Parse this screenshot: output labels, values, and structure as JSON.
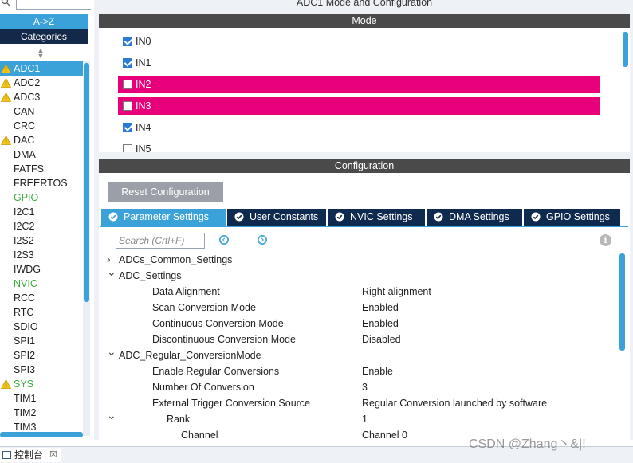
{
  "sidebar": {
    "az_label": "A->Z",
    "categories_label": "Categories",
    "items": [
      {
        "label": "ADC1",
        "warn": true,
        "selected": true,
        "green": false
      },
      {
        "label": "ADC2",
        "warn": true,
        "selected": false,
        "green": false
      },
      {
        "label": "ADC3",
        "warn": true,
        "selected": false,
        "green": false
      },
      {
        "label": "CAN",
        "warn": false,
        "selected": false,
        "green": false
      },
      {
        "label": "CRC",
        "warn": false,
        "selected": false,
        "green": false
      },
      {
        "label": "DAC",
        "warn": true,
        "selected": false,
        "green": false
      },
      {
        "label": "DMA",
        "warn": false,
        "selected": false,
        "green": false
      },
      {
        "label": "FATFS",
        "warn": false,
        "selected": false,
        "green": false
      },
      {
        "label": "FREERTOS",
        "warn": false,
        "selected": false,
        "green": false
      },
      {
        "label": "GPIO",
        "warn": false,
        "selected": false,
        "green": true
      },
      {
        "label": "I2C1",
        "warn": false,
        "selected": false,
        "green": false
      },
      {
        "label": "I2C2",
        "warn": false,
        "selected": false,
        "green": false
      },
      {
        "label": "I2S2",
        "warn": false,
        "selected": false,
        "green": false
      },
      {
        "label": "I2S3",
        "warn": false,
        "selected": false,
        "green": false
      },
      {
        "label": "IWDG",
        "warn": false,
        "selected": false,
        "green": false
      },
      {
        "label": "NVIC",
        "warn": false,
        "selected": false,
        "green": true
      },
      {
        "label": "RCC",
        "warn": false,
        "selected": false,
        "green": false
      },
      {
        "label": "RTC",
        "warn": false,
        "selected": false,
        "green": false
      },
      {
        "label": "SDIO",
        "warn": false,
        "selected": false,
        "green": false
      },
      {
        "label": "SPI1",
        "warn": false,
        "selected": false,
        "green": false
      },
      {
        "label": "SPI2",
        "warn": false,
        "selected": false,
        "green": false
      },
      {
        "label": "SPI3",
        "warn": false,
        "selected": false,
        "green": false
      },
      {
        "label": "SYS",
        "warn": true,
        "selected": false,
        "green": true
      },
      {
        "label": "TIM1",
        "warn": false,
        "selected": false,
        "green": false
      },
      {
        "label": "TIM2",
        "warn": false,
        "selected": false,
        "green": false
      },
      {
        "label": "TIM3",
        "warn": false,
        "selected": false,
        "green": false
      }
    ]
  },
  "panel": {
    "title": "ADC1 Mode and Configuration",
    "mode_header": "Mode",
    "config_header": "Configuration"
  },
  "mode": {
    "inputs": [
      {
        "label": "IN0",
        "checked": true,
        "highlight": false
      },
      {
        "label": "IN1",
        "checked": true,
        "highlight": false
      },
      {
        "label": "IN2",
        "checked": false,
        "highlight": true
      },
      {
        "label": "IN3",
        "checked": false,
        "highlight": true
      },
      {
        "label": "IN4",
        "checked": true,
        "highlight": false
      },
      {
        "label": "IN5",
        "checked": false,
        "highlight": false
      }
    ]
  },
  "config": {
    "reset_label": "Reset Configuration",
    "tabs": [
      {
        "label": "Parameter Settings",
        "active": true
      },
      {
        "label": "User Constants",
        "active": false
      },
      {
        "label": "NVIC Settings",
        "active": false
      },
      {
        "label": "DMA Settings",
        "active": false
      },
      {
        "label": "GPIO Settings",
        "active": false
      }
    ],
    "search_placeholder": "Search (Crtl+F)",
    "tree": [
      {
        "name": "ADCs_Common_Settings",
        "value": "",
        "arrow": "collapsed",
        "level": 0
      },
      {
        "name": "ADC_Settings",
        "value": "",
        "arrow": "expanded",
        "level": 0
      },
      {
        "name": "Data Alignment",
        "value": "Right alignment",
        "arrow": "",
        "level": 1
      },
      {
        "name": "Scan Conversion Mode",
        "value": "Enabled",
        "arrow": "",
        "level": 1
      },
      {
        "name": "Continuous Conversion Mode",
        "value": "Enabled",
        "arrow": "",
        "level": 1
      },
      {
        "name": "Discontinuous Conversion Mode",
        "value": "Disabled",
        "arrow": "",
        "level": 1
      },
      {
        "name": "ADC_Regular_ConversionMode",
        "value": "",
        "arrow": "expanded",
        "level": 0
      },
      {
        "name": "Enable Regular Conversions",
        "value": "Enable",
        "arrow": "",
        "level": 1
      },
      {
        "name": "Number Of Conversion",
        "value": "3",
        "arrow": "",
        "level": 1
      },
      {
        "name": "External Trigger Conversion Source",
        "value": "Regular Conversion launched by software",
        "arrow": "",
        "level": 1
      },
      {
        "name": "Rank",
        "value": "1",
        "arrow": "expanded",
        "level": 2
      },
      {
        "name": "Channel",
        "value": "Channel 0",
        "arrow": "",
        "level": 3
      }
    ]
  },
  "bottom": {
    "console_label": "控制台",
    "close_glyph": "☒",
    "watermark": "CSDN @Zhang丶&|!"
  },
  "colors": {
    "accent": "#3aa2d8",
    "navy": "#12294a",
    "highlight": "#e8007a",
    "header_bar": "#4a4a4a",
    "green": "#3cab3c"
  }
}
